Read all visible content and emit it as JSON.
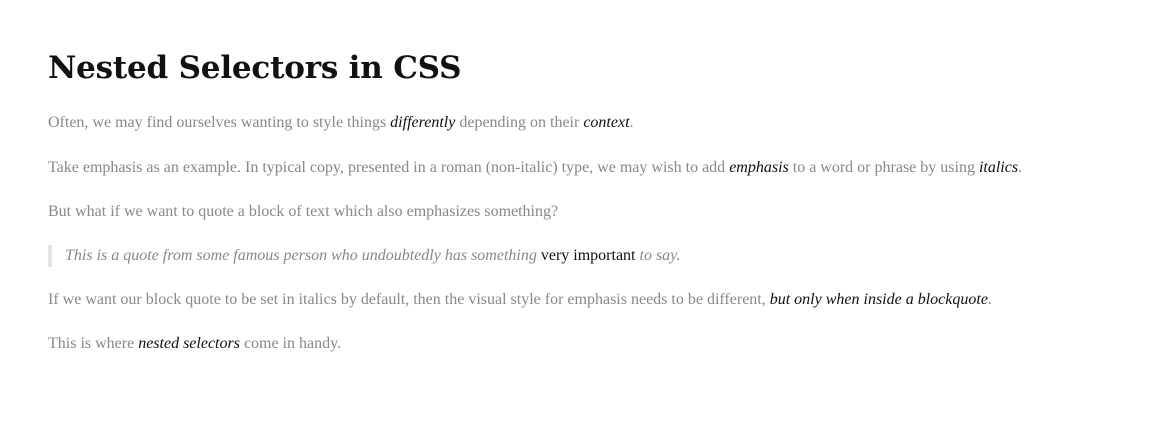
{
  "article": {
    "title": "Nested Selectors in CSS",
    "p1": {
      "t1": "Often, we may find ourselves wanting to style things ",
      "e1": "differently",
      "t2": " depending on their ",
      "e2": "context",
      "t3": "."
    },
    "p2": {
      "t1": "Take emphasis as an example. In typical copy, presented in a roman (non-italic) type, we may wish to add ",
      "e1": "emphasis",
      "t2": " to a word or phrase by using ",
      "e2": "italics",
      "t3": "."
    },
    "p3": {
      "t1": "But what if we want to quote a block of text which also emphasizes something?"
    },
    "quote": {
      "t1": "This is a quote from some famous person who undoubtedly has something ",
      "e1": "very important",
      "t2": " to say",
      "t3": "."
    },
    "p4": {
      "t1": "If we want our block quote to be set in italics by default, then the visual style for emphasis needs to be different, ",
      "e1": "but only when inside a blockquote",
      "t2": "."
    },
    "p5": {
      "t1": "This is where ",
      "e1": "nested selectors",
      "t2": " come in handy."
    }
  }
}
